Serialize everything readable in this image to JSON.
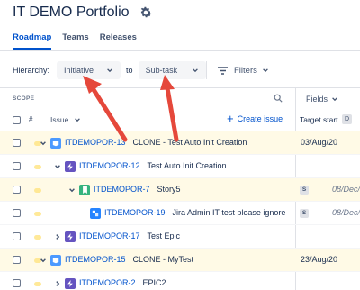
{
  "header": {
    "title": "IT DEMO Portfolio"
  },
  "tabs": [
    {
      "label": "Roadmap",
      "active": true
    },
    {
      "label": "Teams",
      "active": false
    },
    {
      "label": "Releases",
      "active": false
    }
  ],
  "hierarchy": {
    "label": "Hierarchy:",
    "from": "Initiative",
    "to_label": "to",
    "to": "Sub-task"
  },
  "filters_label": "Filters",
  "scope_label": "SCOPE",
  "fields_label": "Fields",
  "columns": {
    "hash": "#",
    "issue": "Issue",
    "create": "Create issue",
    "target_start": "Target start",
    "target_badge": "D"
  },
  "rows": [
    {
      "key": "ITDEMOPOR-13",
      "summary": "CLONE - Test Auto Init Creation",
      "type": "initiative",
      "indent": 0,
      "expanded": true,
      "highlight": true,
      "badge": "",
      "date": "03/Aug/20",
      "date_style": "normal"
    },
    {
      "key": "ITDEMOPOR-12",
      "summary": "Test Auto Init Creation",
      "type": "epic",
      "indent": 1,
      "expanded": true,
      "highlight": false,
      "badge": "",
      "date": "",
      "date_style": "normal"
    },
    {
      "key": "ITDEMOPOR-7",
      "summary": "Story5",
      "type": "story",
      "indent": 2,
      "expanded": true,
      "highlight": true,
      "badge": "S",
      "date": "08/Dec/",
      "date_style": "italic"
    },
    {
      "key": "ITDEMOPOR-19",
      "summary": "Jira Admin IT test please ignore",
      "type": "subtask",
      "indent": 3,
      "expanded": false,
      "highlight": false,
      "badge": "S",
      "date": "08/Dec/",
      "date_style": "italic"
    },
    {
      "key": "ITDEMOPOR-17",
      "summary": "Test Epic",
      "type": "epic",
      "indent": 1,
      "expanded": false,
      "highlight": false,
      "badge": "",
      "date": "",
      "date_style": "normal"
    },
    {
      "key": "ITDEMOPOR-15",
      "summary": "CLONE - MyTest",
      "type": "initiative",
      "indent": 0,
      "expanded": true,
      "highlight": true,
      "badge": "",
      "date": "23/Aug/20",
      "date_style": "normal"
    },
    {
      "key": "ITDEMOPOR-2",
      "summary": "EPIC2",
      "type": "epic",
      "indent": 1,
      "expanded": false,
      "highlight": false,
      "badge": "",
      "date": "",
      "date_style": "normal"
    }
  ],
  "colors": {
    "accent": "#0052CC",
    "highlight_row": "#FFFAE6",
    "annotation_arrow": "#E5483B",
    "initiative": "#4C9AFF",
    "epic": "#6554C0",
    "story": "#36B37E",
    "subtask": "#2684FF"
  }
}
